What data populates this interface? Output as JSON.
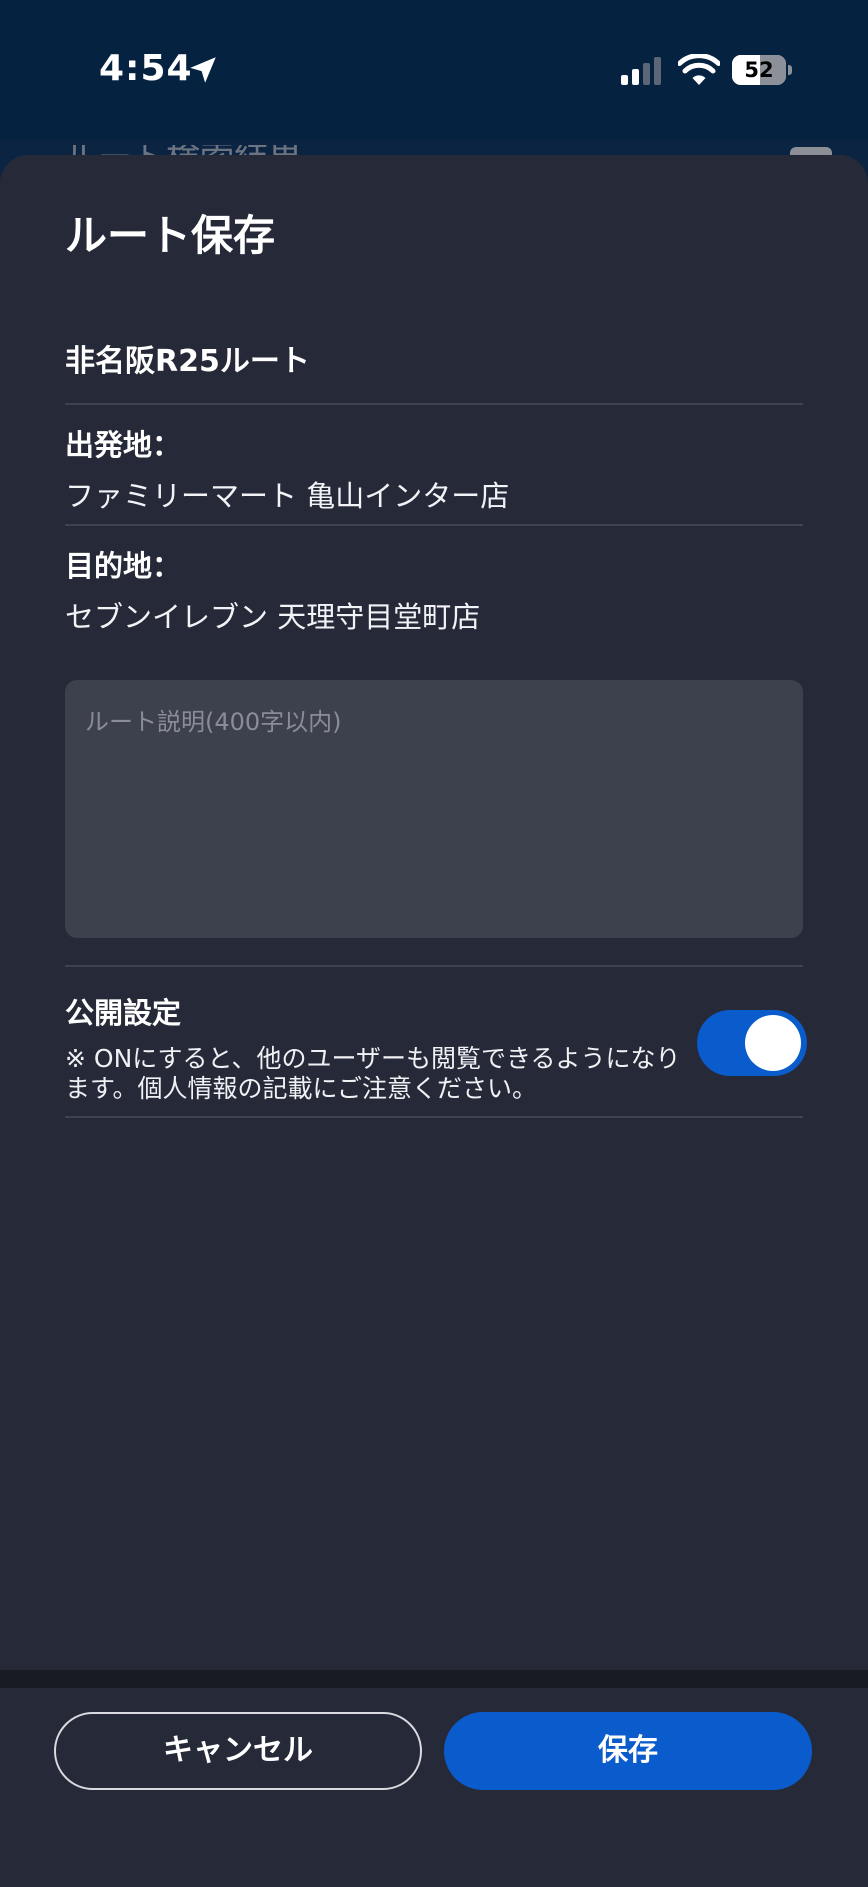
{
  "status_bar": {
    "time": "4:54",
    "battery": "52",
    "battery_level_percent": 52
  },
  "background_page": {
    "title": "…ルート検索結果"
  },
  "sheet": {
    "title": "ルート保存",
    "route_name": "非名阪R25ルート",
    "origin": {
      "label": "出発地：",
      "value": "ファミリーマート 亀山インター店"
    },
    "destination": {
      "label": "目的地：",
      "value": "セブンイレブン 天理守目堂町店"
    },
    "description": {
      "placeholder": "ルート説明(400字以内)",
      "value": ""
    },
    "public_setting": {
      "label": "公開設定",
      "note": "※ ONにすると、他のユーザーも閲覧できるようになります。個人情報の記載にご注意ください。",
      "enabled": true
    }
  },
  "footer": {
    "cancel_label": "キャンセル",
    "save_label": "保存"
  },
  "colors": {
    "accent": "#0a5bcb",
    "sheet_bg": "#262a38",
    "status_bg": "#062241"
  }
}
